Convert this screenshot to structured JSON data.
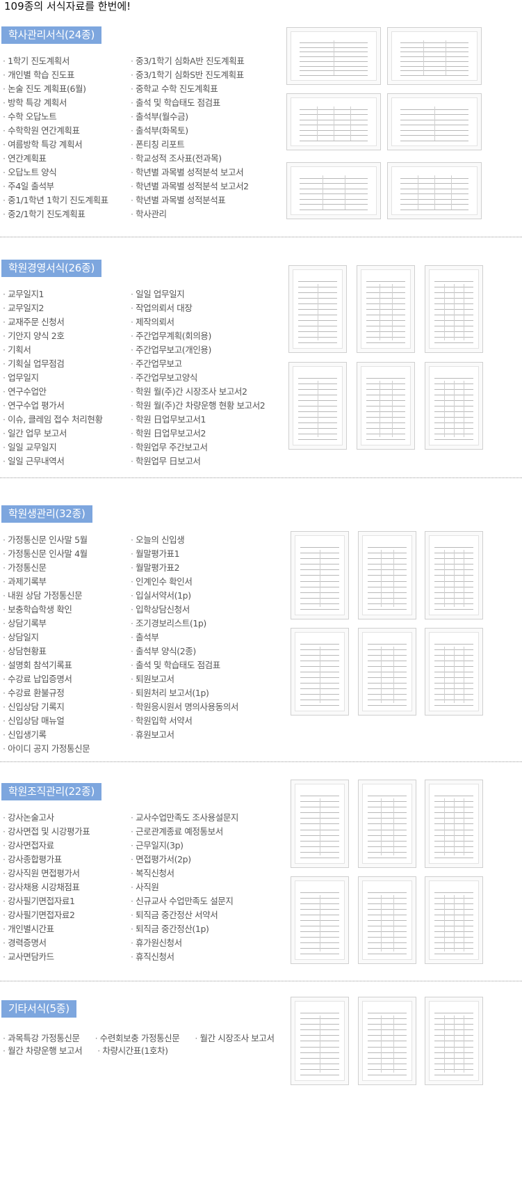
{
  "headline": "109종의 서식자료를 한번에!",
  "sections": [
    {
      "title": "학사관리서식(24종)",
      "col1": [
        "1학기 진도계획서",
        "개인별 학습 진도표",
        "논술 진도 계획표(6월)",
        "방학 특강 계획서",
        "수학 오답노트",
        "수학학원 연간계획표",
        "여름방학 특강 계획서",
        "연간계획표",
        "오답노트 양식",
        "주4일 출석부",
        "중1/1학년 1학기 진도계획표",
        "중2/1학기 진도계획표"
      ],
      "col2": [
        "중3/1학기 심화A반 진도계획표",
        "중3/1학기 심화S반 진도계획표",
        "중학교 수학 진도계획표",
        "출석 및 학습태도 점검표",
        "출석부(월수금)",
        "출석부(화목토)",
        "폰티칭 리포트",
        "학교성적 조사표(전과목)",
        "학년별 과목별 성적분석 보고서",
        "학년별 과목별 성적분석 보고서2",
        "학년별 과목별 성적분석표",
        "학사관리"
      ]
    },
    {
      "title": "학원경영서식(26종)",
      "col1": [
        "교무일지1",
        "교무일지2",
        "교재주문 신청서",
        "기안지 양식 2호",
        "기획서",
        "기획실 업무점검",
        "업무일지",
        "연구수업안",
        "연구수업 평가서",
        "이슈, 클레임 접수 처리현황",
        "일간 업무 보고서",
        "일일 교무일지",
        "일일 근무내역서"
      ],
      "col2": [
        "일일 업무일지",
        "작업의뢰서 대장",
        "제작의뢰서",
        "주간업무계획(회의용)",
        "주간업무보고(개인용)",
        "주간업무보고",
        "주간업무보고양식",
        "학원 월(주)간 시장조사 보고서2",
        "학원 월(주)간 차량운행 현황 보고서2",
        "학원 日업무보고서1",
        "학원 日업무보고서2",
        "학원업무 주간보고서",
        "학원업무 日보고서"
      ]
    },
    {
      "title": "학원생관리(32종)",
      "col1": [
        "가정통신문 인사말 5월",
        "가정통신문 인사말 4월",
        "가정통신문",
        "과제기록부",
        "내원 상담 가정통신문",
        "보충학습학생 확인",
        "상담기록부",
        "상담일지",
        "상담현황표",
        "설명회 참석기록표",
        "수강료 납입증명서",
        "수강료 환불규정",
        "신입상담 기록지",
        "신입상담 매뉴얼",
        "신입생기록",
        "아이디 공지 가정통신문"
      ],
      "col2": [
        "오늘의 신입생",
        "월말평가표1",
        "월말평가표2",
        "인계인수 확인서",
        "입실서약서(1p)",
        "입학상담신청서",
        "조기경보리스트(1p)",
        "출석부",
        "출석부 양식(2종)",
        "출석 및 학습태도 점검표",
        "퇴원보고서",
        "퇴원처리 보고서(1p)",
        "학원응시원서 명의사용동의서",
        "학원입학 서약서",
        "휴원보고서"
      ]
    },
    {
      "title": "학원조직관리(22종)",
      "col1": [
        "강사논술고사",
        "강사면접 및 시강평가표",
        "강사면접자료",
        "강사종합평가표",
        "강사직원 면접평가서",
        "강사채용 시강채점표",
        "강사필기면접자료1",
        "강사필기면접자료2",
        "개인별시간표",
        "경력증명서",
        "교사면담카드"
      ],
      "col2": [
        "교사수업만족도 조사용설문지",
        "근로관계종료 예정통보서",
        "근무일지(3p)",
        "면접평가서(2p)",
        "복직신청서",
        "사직원",
        "신규교사 수업만족도 설문지",
        "퇴직금 중간정산 서약서",
        "퇴직금 중간정산(1p)",
        "휴가원신청서",
        "휴직신청서"
      ]
    },
    {
      "title": "기타서식(5종)",
      "row1": [
        "과목특강 가정통신문",
        "수련회보충 가정통신문",
        "월간 시장조사 보고서"
      ],
      "row2": [
        "월간 차량운행 보고서",
        "차량시간표(1호차)"
      ]
    }
  ]
}
